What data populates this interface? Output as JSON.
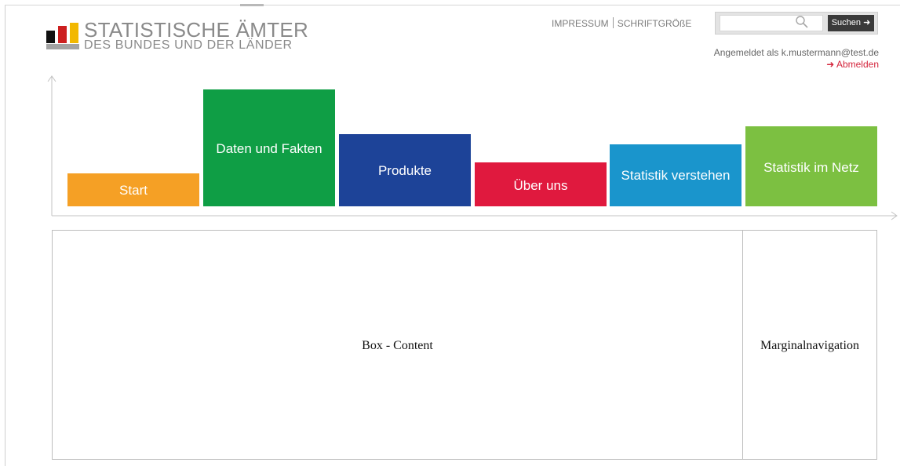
{
  "logo": {
    "line1": "STATISTISCHE ÄMTER",
    "line2": "DES BUNDES UND DER LÄNDER"
  },
  "meta_nav": {
    "impressum": "IMPRESSUM",
    "schriftgroesse": "SCHRIFTGRÖßE"
  },
  "search": {
    "placeholder": "",
    "value": "",
    "button_label": "Suchen ➜"
  },
  "user": {
    "logged_in_text": "Angemeldet als k.mustermann@test.de",
    "logout_label": "➜ Abmelden"
  },
  "main_nav": [
    {
      "label": "Start",
      "color": "#f5a025"
    },
    {
      "label": "Daten und Fakten",
      "color": "#0f9e45"
    },
    {
      "label": "Produkte",
      "color": "#1d4398"
    },
    {
      "label": "Über uns",
      "color": "#e0193e"
    },
    {
      "label": "Statistik verstehen",
      "color": "#1a95cc"
    },
    {
      "label": "Statistik im Netz",
      "color": "#7cc041"
    }
  ],
  "content": {
    "main_label": "Box - Content",
    "side_label": "Marginalnavigation"
  }
}
